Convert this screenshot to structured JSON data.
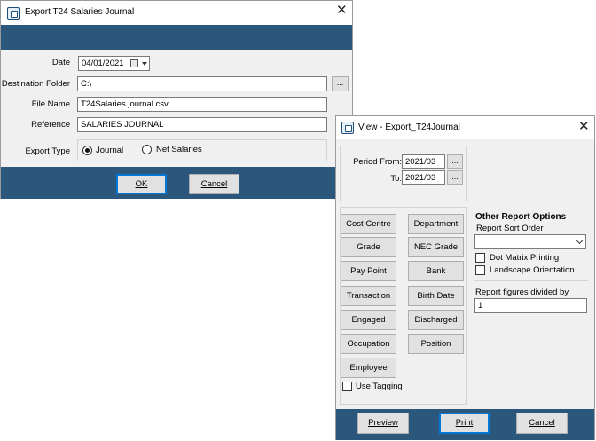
{
  "export_dialog": {
    "title": "Export T24 Salaries Journal",
    "close_glyph": "✕",
    "date_label": "Date",
    "date_value": "04/01/2021",
    "destination_label": "Destination Folder",
    "destination_value": "C:\\",
    "browse_label": "...",
    "file_name_label": "File Name",
    "file_name_value": "T24Salaries journal.csv",
    "reference_label": "Reference",
    "reference_value": "SALARIES JOURNAL",
    "export_type_label": "Export Type",
    "option_journal": "Journal",
    "option_net_salaries": "Net Salaries",
    "selected_option": "Journal",
    "ok_label": "OK",
    "cancel_label": "Cancel",
    "band_color": "#2c577d"
  },
  "view_dialog": {
    "title": "View - Export_T24Journal",
    "close_glyph": "✕",
    "period_from_label": "Period From:",
    "period_from_value": "2021/03",
    "period_to_label": "To:",
    "period_to_value": "2021/03",
    "browse_label": "...",
    "report_buttons": [
      "Cost Centre",
      "Department",
      "Grade",
      "NEC Grade",
      "Pay Point",
      "Bank",
      "Transaction",
      "Birth Date",
      "Engaged",
      "Discharged",
      "Occupation",
      "Position",
      "Employee"
    ],
    "use_tagging_label": "Use Tagging",
    "other_options_heading": "Other Report Options",
    "sort_order_label": "Report Sort Order",
    "sort_order_value": "",
    "dot_matrix_label": "Dot Matrix Printing",
    "landscape_label": "Landscape Orientation",
    "divided_by_label": "Report figures divided by",
    "divided_by_value": "1",
    "preview_label": "Preview",
    "print_label": "Print",
    "cancel_label": "Cancel"
  }
}
